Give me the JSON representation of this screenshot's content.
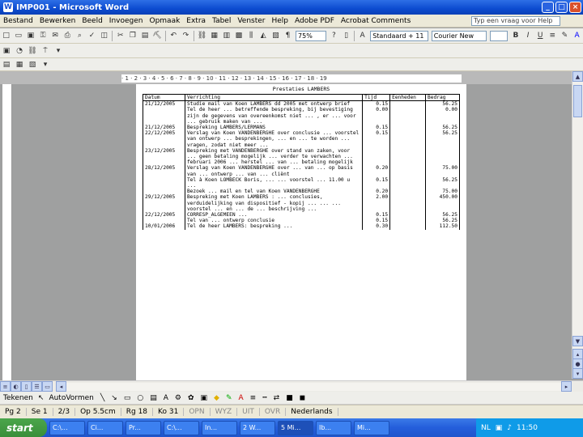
{
  "window": {
    "title": "IMP001 - Microsoft Word",
    "min": "_",
    "max": "□",
    "close": "×"
  },
  "menu": {
    "items": [
      "Bestand",
      "Bewerken",
      "Beeld",
      "Invoegen",
      "Opmaak",
      "Extra",
      "Tabel",
      "Venster",
      "Help",
      "Adobe PDF",
      "Acrobat Comments"
    ],
    "help_placeholder": "Typ een vraag voor Help"
  },
  "toolbar": {
    "zoom": "75%",
    "style": "Standaard + 11",
    "font": "Courier New",
    "bold": "B",
    "italic": "I",
    "underline": "U"
  },
  "ruler": {
    "marks": "· 1 · 2 · 3 · 4 · 5 · 6 · 7 · 8 · 9 · 10 · 11 · 12 · 13 · 14 · 15 · 16 · 17 · 18 · 19"
  },
  "document": {
    "title": "Prestaties LAMBERS",
    "columns": [
      "Datum",
      "Verrichting",
      "Tijd",
      "Eenheden",
      "Bedrag"
    ],
    "rows": [
      {
        "date": "21/12/2005",
        "desc": "Studie mail van Koen LAMBERS dd 2005 met ontwerp brief",
        "time": "0.15",
        "units": "",
        "amount": "56.25"
      },
      {
        "date": "",
        "desc": "Tel de heer ... betreffende bespreking, bij bevestiging zijn de gegevens van overeenkomst niet ... , er ... voor ... gebruik maken van ... ",
        "time": "0.00",
        "units": "",
        "amount": "0.00"
      },
      {
        "date": "21/12/2005",
        "desc": "Bespreking LAMBERS/LERMANS",
        "time": "0.15",
        "units": "",
        "amount": "56.25"
      },
      {
        "date": "22/12/2005",
        "desc": "Verslag van Koen VANDENBERGHE over conclusie ... voorstel van ontwerp ... besprekingen, ... en ... te worden ... vragen, zodat niet meer ... ",
        "time": "0.15",
        "units": "",
        "amount": "56.25"
      },
      {
        "date": "23/12/2005",
        "desc": "Bespreking met VANDENBERGHE over stand van zaken, voor ... geen betaling mogelijk ... verder te verwachten ... februari 2006 ... herstel ... van ... betaling mogelijk",
        "time": "",
        "units": "",
        "amount": ""
      },
      {
        "date": "28/12/2005",
        "desc": "Verslag van Koen VANDENBERGHE over ... van ... op basis van ... ontwerp ... van ... cliënt",
        "time": "0.20",
        "units": "",
        "amount": "75.00"
      },
      {
        "date": "",
        "desc": "Tel à Koen LOMBECK Boris, ... ... voorstel ... 11.00 u ... ",
        "time": "0.15",
        "units": "",
        "amount": "56.25"
      },
      {
        "date": "",
        "desc": "Bezoek ... mail en tel van Koen VANDENBERGHE",
        "time": "0.20",
        "units": "",
        "amount": "75.00"
      },
      {
        "date": "29/12/2005",
        "desc": "Bespreking met Koen LAMBERS : ... conclusies, verduidelijking van dispositief - kopij ... ... ... voorstel ... en ... de ... beschrijving ... ",
        "time": "2.00",
        "units": "",
        "amount": "450.00"
      },
      {
        "date": "22/12/2005",
        "desc": "CORRESP_ALGEMEEN ... ",
        "time": "0.15",
        "units": "",
        "amount": "56.25"
      },
      {
        "date": "",
        "desc": "Tel van ... ontwerp conclusie",
        "time": "0.15",
        "units": "",
        "amount": "56.25"
      },
      {
        "date": "10/01/2006",
        "desc": "Tel de heer LAMBERS: bespreking ... ",
        "time": "0.30",
        "units": "",
        "amount": "112.50"
      }
    ]
  },
  "status": {
    "page": "Pg 2",
    "section": "Se 1",
    "pages": "2/3",
    "at": "Op 5.5cm",
    "line": "Rg 18",
    "col": "Ko 31",
    "rec": "OPN",
    "trk": "WYZ",
    "ext": "UIT",
    "ovr": "OVR",
    "lang": "Nederlands"
  },
  "draw": {
    "draw_label": "Tekenen",
    "autoshapes_label": "AutoVormen"
  },
  "taskbar": {
    "start": "start",
    "tasks": [
      "C:\\...",
      "Ci...",
      "Pr...",
      "C:\\...",
      "In...",
      "2 W...",
      "5 Mi...",
      "Ib...",
      "Mi...",
      "Mi..."
    ],
    "lang": "NL",
    "clock": "11:50"
  }
}
